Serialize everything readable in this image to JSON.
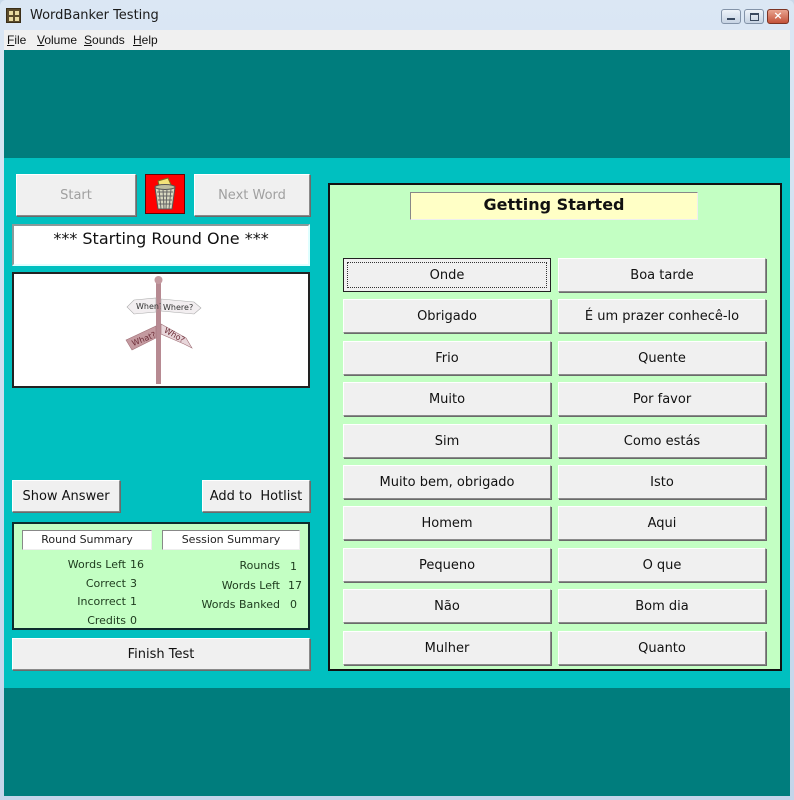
{
  "window": {
    "title": "WordBanker Testing",
    "controls": {
      "minimize": "minimize",
      "maximize": "maximize",
      "close": "×"
    }
  },
  "menu": [
    {
      "label": "File",
      "accel": "F"
    },
    {
      "label": "Volume",
      "accel": "V"
    },
    {
      "label": "Sounds",
      "accel": "S"
    },
    {
      "label": "Help",
      "accel": "H"
    }
  ],
  "controls": {
    "start_label": "Start",
    "next_word_label": "Next Word",
    "show_answer_label": "Show Answer",
    "add_hotlist_label": "Add to  Hotlist",
    "finish_test_label": "Finish Test"
  },
  "status_message": "*** Starting Round One ***",
  "image": {
    "description": "signpost",
    "signs": [
      "When?",
      "Where?",
      "What?",
      "Who?"
    ]
  },
  "round_summary": {
    "title": "Round Summary",
    "rows": [
      {
        "label": "Words Left",
        "value": "16"
      },
      {
        "label": "Correct",
        "value": "3"
      },
      {
        "label": "Incorrect",
        "value": "1"
      },
      {
        "label": "Credits",
        "value": "0"
      }
    ]
  },
  "session_summary": {
    "title": "Session Summary",
    "rows": [
      {
        "label": "Rounds",
        "value": "1"
      },
      {
        "label": "Words Left",
        "value": "17"
      },
      {
        "label": "Words Banked",
        "value": "0"
      }
    ]
  },
  "panel": {
    "title": "Getting Started",
    "words": [
      [
        "Onde",
        "Boa tarde"
      ],
      [
        "Obrigado",
        "É um prazer conhecê-lo"
      ],
      [
        "Frio",
        "Quente"
      ],
      [
        "Muito",
        "Por favor"
      ],
      [
        "Sim",
        "Como estás"
      ],
      [
        "Muito bem, obrigado",
        "Isto"
      ],
      [
        "Homem",
        "Aqui"
      ],
      [
        "Pequeno",
        "O que"
      ],
      [
        "Não",
        "Bom dia"
      ],
      [
        "Mulher",
        "Quanto"
      ]
    ],
    "focused_word": "Onde"
  },
  "colors": {
    "outer_teal": "#007d7d",
    "cyan": "#00c0c0",
    "panel_green": "#c3ffc3",
    "title_yellow": "#ffffc6",
    "trash_red": "#ff0000"
  }
}
